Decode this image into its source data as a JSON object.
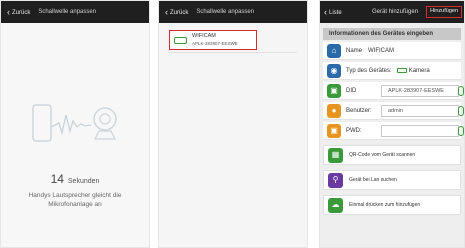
{
  "colors": {
    "topbar": "#1f1f1f",
    "highlight": "#d62b2b",
    "accent_blue": "#2b6aa8",
    "accent_green": "#3a9a3a",
    "accent_orange": "#e69520",
    "accent_purple": "#6a3aa0"
  },
  "screen1": {
    "back": "Zurück",
    "title": "Schallwelle anpassen",
    "countdown_number": "14",
    "countdown_unit": "Sekunden",
    "hint": "Handys Lautsprecher gleicht die Mikrofonanlage an"
  },
  "screen2": {
    "back": "Zurück",
    "title": "Schallwelle anpassen",
    "device_name": "WIFICAM",
    "device_id": "APLK-283907-EESWE"
  },
  "screen3": {
    "back": "Liste",
    "title": "Gerät hinzufügen",
    "add_button": "Hinzufügen",
    "section_header": "Informationen des Gerätes eingeben",
    "name_label": "Name",
    "name_value": "WIFICAM",
    "type_label": "Typ des Gerätes:",
    "type_value": "Kamera",
    "did_label": "DID",
    "did_value": "APLK-283907-EESWE",
    "user_label": "Benutzer:",
    "user_value": "admin",
    "pwd_label": "PWD:",
    "pwd_value": "",
    "action_qr": "QR-Code vom Gerät scannen",
    "action_lan": "Gerät bei Lan suchen",
    "action_cloud": "Einmal drücken zum hinzufügen"
  },
  "icons": [
    "back-chevron-icon",
    "sound-wave-icon",
    "camera-icon",
    "home-icon",
    "camera-type-icon",
    "did-icon",
    "user-icon",
    "lock-icon",
    "qr-code-icon",
    "search-icon",
    "cloud-add-icon"
  ]
}
